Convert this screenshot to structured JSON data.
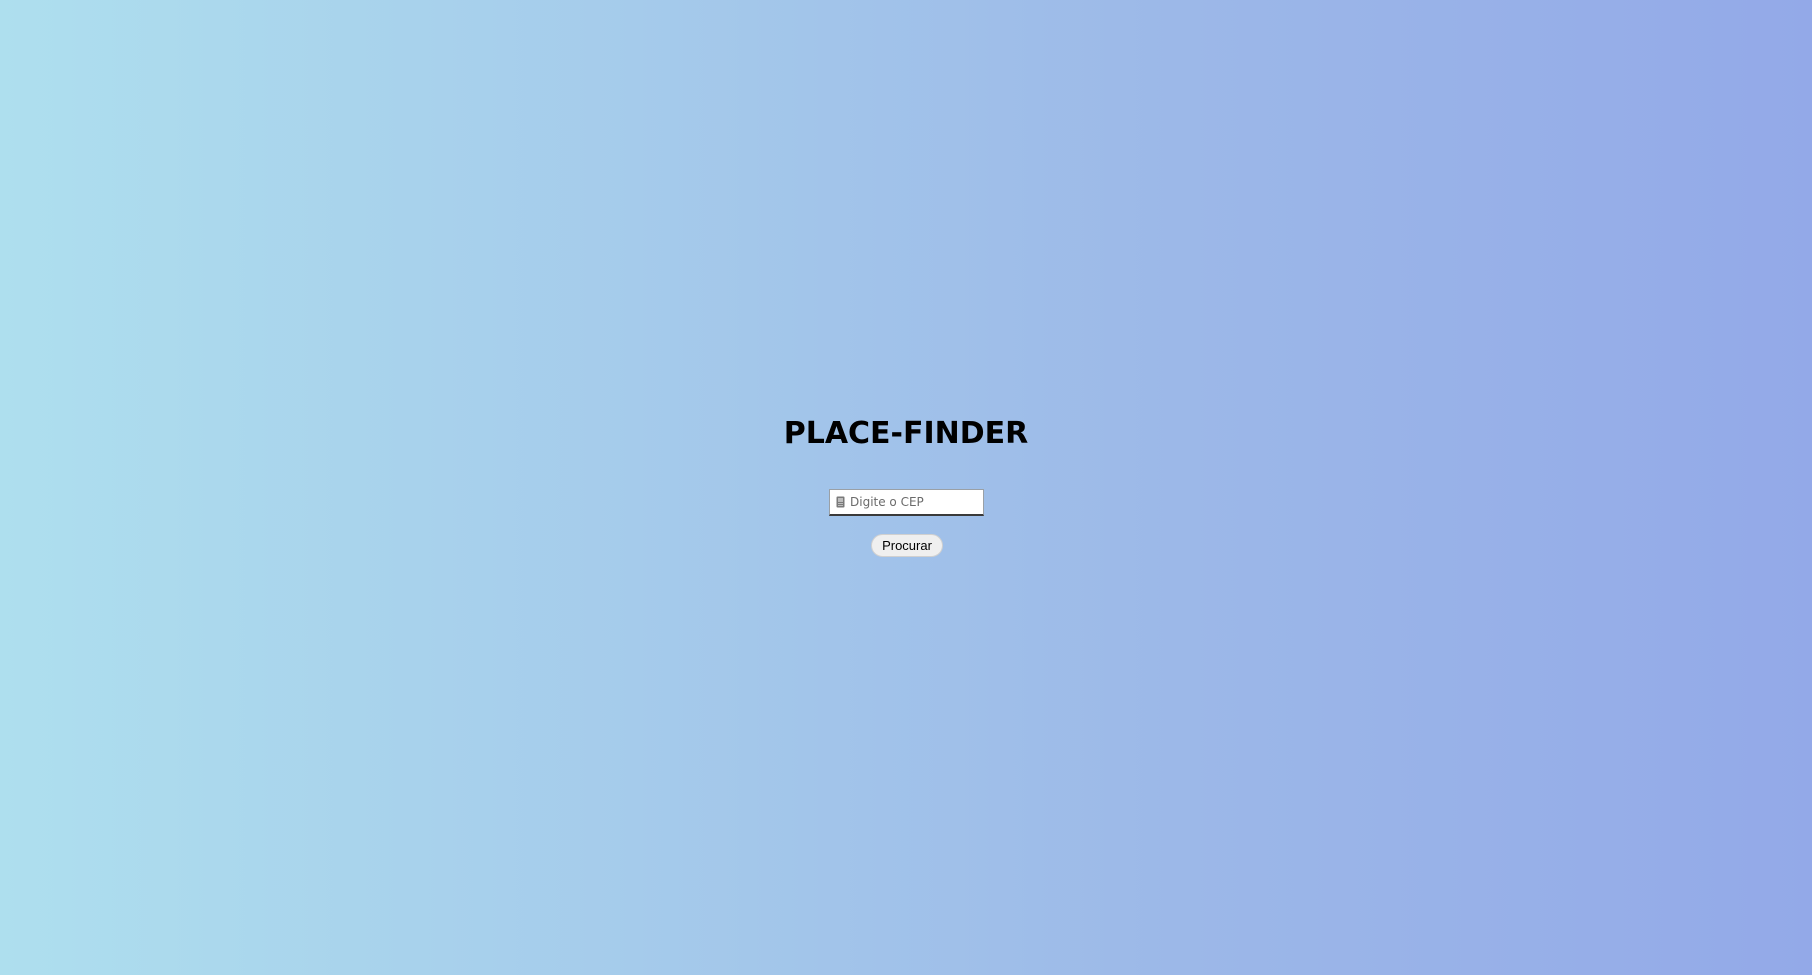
{
  "page": {
    "title": "PLACE-FINDER",
    "background_colors": [
      "#aedfee",
      "#93a9e8"
    ]
  },
  "search": {
    "icon": "location-pin-icon",
    "placeholder": "Digite o CEP",
    "value": ""
  },
  "actions": {
    "search_label": "Procurar"
  }
}
